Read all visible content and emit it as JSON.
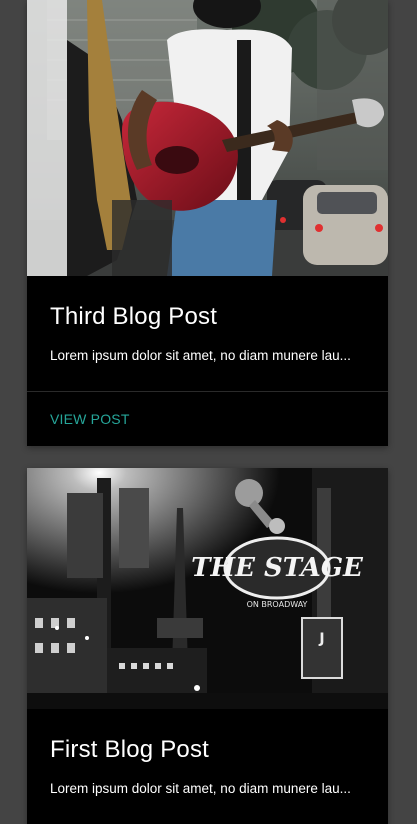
{
  "posts": [
    {
      "title": "Third Blog Post",
      "excerpt": "Lorem ipsum dolor sit amet, no diam munere lau...",
      "action_label": "VIEW POST",
      "image": "guitarist-street-photo"
    },
    {
      "title": "First Blog Post",
      "excerpt": "Lorem ipsum dolor sit amet, no diam munere lau...",
      "image": "the-stage-on-broadway-night-photo",
      "image_sign_text": "THE STAGE",
      "image_sign_subtext": "ON BROADWAY"
    }
  ],
  "colors": {
    "page_background": "#444444",
    "card_background": "#000000",
    "accent": "#26a69a",
    "text": "#ffffff"
  }
}
